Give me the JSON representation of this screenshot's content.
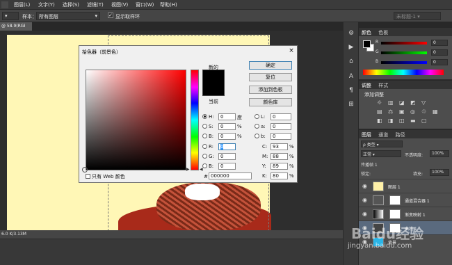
{
  "menubar": {
    "items": [
      "图层(L)",
      "文字(Y)",
      "选择(S)",
      "滤镜(T)",
      "视图(V)",
      "窗口(W)",
      "帮助(H)"
    ]
  },
  "options": {
    "sample_label": "样本：",
    "sample_value": "所有图层",
    "show_ring_label": "显示取样环",
    "right_dropdown": "未标题-1"
  },
  "document": {
    "tab_label": "@ 58.9(RGB/8#) *",
    "status": "6.0 K/3.13M"
  },
  "color_picker": {
    "title": "拾色器（前景色）",
    "close": "×",
    "new_label": "新的",
    "current_label": "当前",
    "buttons": {
      "ok": "确定",
      "reset": "复位",
      "add_swatch": "添加到色板",
      "color_lib": "颜色库"
    },
    "fields": {
      "H": {
        "label": "H:",
        "value": "0",
        "unit": "度"
      },
      "S": {
        "label": "S:",
        "value": "0",
        "unit": "%"
      },
      "Bv": {
        "label": "B:",
        "value": "0",
        "unit": "%"
      },
      "R": {
        "label": "R:",
        "value": "0"
      },
      "G": {
        "label": "G:",
        "value": "0"
      },
      "Bc": {
        "label": "B:",
        "value": "0"
      },
      "L": {
        "label": "L:",
        "value": "0"
      },
      "a": {
        "label": "a:",
        "value": "0"
      },
      "b": {
        "label": "b:",
        "value": "0"
      },
      "C": {
        "label": "C:",
        "value": "93",
        "unit": "%"
      },
      "M": {
        "label": "M:",
        "value": "88",
        "unit": "%"
      },
      "Y": {
        "label": "Y:",
        "value": "89",
        "unit": "%"
      },
      "K": {
        "label": "K:",
        "value": "80",
        "unit": "%"
      }
    },
    "web_only": "只有 Web 颜色",
    "hex_prefix": "#",
    "hex": "000000"
  },
  "panels": {
    "color_tabs": [
      "颜色",
      "色板"
    ],
    "color_rows": [
      {
        "label": "R",
        "value": "0"
      },
      {
        "label": "G",
        "value": "0"
      },
      {
        "label": "B",
        "value": "0"
      }
    ],
    "adjust_tabs": [
      "调整",
      "样式"
    ],
    "adjust_label": "添加调整",
    "layers_tabs": [
      "图层",
      "通道",
      "路径"
    ],
    "kind_label": "ρ 类型",
    "blend_mode": "正常",
    "opacity_label": "不透明度:",
    "opacity_value": "100%",
    "lock_label": "锁定:",
    "fill_label": "填充:",
    "fill_value": "100%",
    "propagate_label": "传播帧 1",
    "layers": [
      {
        "name": "图层 1"
      },
      {
        "name": "通道混合器 1"
      },
      {
        "name": "渐变映射 1"
      },
      {
        "name": "曲线 1"
      },
      {
        "name": "背景"
      }
    ]
  },
  "watermark": {
    "brand": "Baidu经验",
    "url": "jingyan.baidu.com"
  }
}
